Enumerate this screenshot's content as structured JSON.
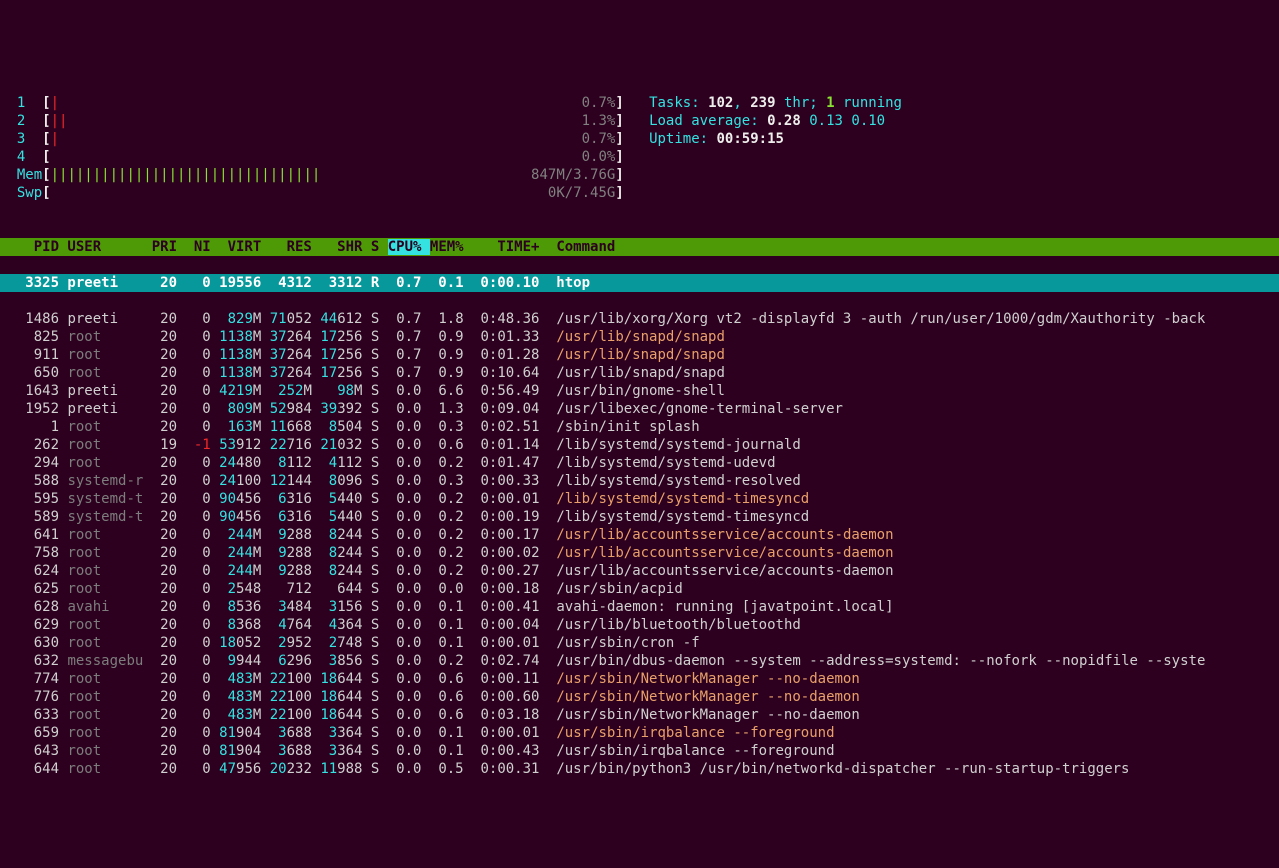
{
  "cpus": [
    {
      "id": "1",
      "bar": "|",
      "barClass": "red",
      "pct": "0.7%"
    },
    {
      "id": "2",
      "bar": "||",
      "barClass": "red",
      "pct": "1.3%"
    },
    {
      "id": "3",
      "bar": "|",
      "barClass": "red",
      "pct": "0.7%"
    },
    {
      "id": "4",
      "bar": "",
      "barClass": "",
      "pct": "0.0%"
    }
  ],
  "mem": {
    "label": "Mem",
    "bar": "||||||||||||||||||||||||||||||||",
    "value": "847M/3.76G"
  },
  "swp": {
    "label": "Swp",
    "bar": "",
    "value": "0K/7.45G"
  },
  "tasks": {
    "label": "Tasks:",
    "count": "102",
    "sep": ",",
    "thr": "239",
    "thrLabel": "thr;",
    "running": "1",
    "runningLabel": "running"
  },
  "load": {
    "label": "Load average:",
    "v1": "0.28",
    "v2": "0.13",
    "v3": "0.10"
  },
  "uptime": {
    "label": "Uptime:",
    "value": "00:59:15"
  },
  "columns": {
    "pid": "PID",
    "user": "USER",
    "pri": "PRI",
    "ni": "NI",
    "virt": "VIRT",
    "res": "RES",
    "shr": "SHR",
    "s": "S",
    "cpu": "CPU%",
    "mem": "MEM%",
    "time": "TIME+",
    "cmd": "Command"
  },
  "selected": {
    "pid": "3325",
    "user": "preeti",
    "pri": "20",
    "ni": "0",
    "virt": "19556",
    "res": "4312",
    "shr": "3312",
    "s": "R",
    "cpu": "0.7",
    "mem": "0.1",
    "time": "0:00.10",
    "cmd": "htop"
  },
  "rows": [
    {
      "pid": "1486",
      "user": "preeti",
      "userDim": false,
      "pri": "20",
      "ni": "0",
      "virtHi": "829",
      "virtLo": "M",
      "resHi": "71",
      "resLo": "052",
      "shrHi": "44",
      "shrLo": "612",
      "s": "S",
      "cpu": "0.7",
      "mem": "1.8",
      "time": "0:48.36",
      "cmd": "/usr/lib/xorg/Xorg vt2 -displayfd 3 -auth /run/user/1000/gdm/Xauthority -back",
      "cmdDim": false
    },
    {
      "pid": "825",
      "user": "root",
      "userDim": true,
      "pri": "20",
      "ni": "0",
      "virtHi": "1138",
      "virtLo": "M",
      "resHi": "37",
      "resLo": "264",
      "shrHi": "17",
      "shrLo": "256",
      "s": "S",
      "cpu": "0.7",
      "mem": "0.9",
      "time": "0:01.33",
      "cmd": "/usr/lib/snapd/snapd",
      "cmdDim": true
    },
    {
      "pid": "911",
      "user": "root",
      "userDim": true,
      "pri": "20",
      "ni": "0",
      "virtHi": "1138",
      "virtLo": "M",
      "resHi": "37",
      "resLo": "264",
      "shrHi": "17",
      "shrLo": "256",
      "s": "S",
      "cpu": "0.7",
      "mem": "0.9",
      "time": "0:01.28",
      "cmd": "/usr/lib/snapd/snapd",
      "cmdDim": true
    },
    {
      "pid": "650",
      "user": "root",
      "userDim": true,
      "pri": "20",
      "ni": "0",
      "virtHi": "1138",
      "virtLo": "M",
      "resHi": "37",
      "resLo": "264",
      "shrHi": "17",
      "shrLo": "256",
      "s": "S",
      "cpu": "0.7",
      "mem": "0.9",
      "time": "0:10.64",
      "cmd": "/usr/lib/snapd/snapd",
      "cmdDim": false
    },
    {
      "pid": "1643",
      "user": "preeti",
      "userDim": false,
      "pri": "20",
      "ni": "0",
      "virtHi": "4219",
      "virtLo": "M",
      "resHi": "252",
      "resLo": "M",
      "shrHi": "98",
      "shrLo": "M",
      "s": "S",
      "cpu": "0.0",
      "mem": "6.6",
      "time": "0:56.49",
      "cmd": "/usr/bin/gnome-shell",
      "cmdDim": false
    },
    {
      "pid": "1952",
      "user": "preeti",
      "userDim": false,
      "pri": "20",
      "ni": "0",
      "virtHi": "809",
      "virtLo": "M",
      "resHi": "52",
      "resLo": "984",
      "shrHi": "39",
      "shrLo": "392",
      "s": "S",
      "cpu": "0.0",
      "mem": "1.3",
      "time": "0:09.04",
      "cmd": "/usr/libexec/gnome-terminal-server",
      "cmdDim": false
    },
    {
      "pid": "1",
      "user": "root",
      "userDim": true,
      "pri": "20",
      "ni": "0",
      "virtHi": "163",
      "virtLo": "M",
      "resHi": "11",
      "resLo": "668",
      "shrHi": "8",
      "shrLo": "504",
      "s": "S",
      "cpu": "0.0",
      "mem": "0.3",
      "time": "0:02.51",
      "cmd": "/sbin/init splash",
      "cmdDim": false
    },
    {
      "pid": "262",
      "user": "root",
      "userDim": true,
      "pri": "19",
      "ni": "-1",
      "niRed": true,
      "virtHi": "53",
      "virtLo": "912",
      "resHi": "22",
      "resLo": "716",
      "shrHi": "21",
      "shrLo": "032",
      "s": "S",
      "cpu": "0.0",
      "mem": "0.6",
      "time": "0:01.14",
      "cmd": "/lib/systemd/systemd-journald",
      "cmdDim": false
    },
    {
      "pid": "294",
      "user": "root",
      "userDim": true,
      "pri": "20",
      "ni": "0",
      "virtHi": "24",
      "virtLo": "480",
      "resHi": "8",
      "resLo": "112",
      "shrHi": "4",
      "shrLo": "112",
      "s": "S",
      "cpu": "0.0",
      "mem": "0.2",
      "time": "0:01.47",
      "cmd": "/lib/systemd/systemd-udevd",
      "cmdDim": false
    },
    {
      "pid": "588",
      "user": "systemd-r",
      "userDim": true,
      "pri": "20",
      "ni": "0",
      "virtHi": "24",
      "virtLo": "100",
      "resHi": "12",
      "resLo": "144",
      "shrHi": "8",
      "shrLo": "096",
      "s": "S",
      "cpu": "0.0",
      "mem": "0.3",
      "time": "0:00.33",
      "cmd": "/lib/systemd/systemd-resolved",
      "cmdDim": false
    },
    {
      "pid": "595",
      "user": "systemd-t",
      "userDim": true,
      "pri": "20",
      "ni": "0",
      "virtHi": "90",
      "virtLo": "456",
      "resHi": "6",
      "resLo": "316",
      "shrHi": "5",
      "shrLo": "440",
      "s": "S",
      "cpu": "0.0",
      "mem": "0.2",
      "time": "0:00.01",
      "cmd": "/lib/systemd/systemd-timesyncd",
      "cmdDim": true
    },
    {
      "pid": "589",
      "user": "systemd-t",
      "userDim": true,
      "pri": "20",
      "ni": "0",
      "virtHi": "90",
      "virtLo": "456",
      "resHi": "6",
      "resLo": "316",
      "shrHi": "5",
      "shrLo": "440",
      "s": "S",
      "cpu": "0.0",
      "mem": "0.2",
      "time": "0:00.19",
      "cmd": "/lib/systemd/systemd-timesyncd",
      "cmdDim": false
    },
    {
      "pid": "641",
      "user": "root",
      "userDim": true,
      "pri": "20",
      "ni": "0",
      "virtHi": "244",
      "virtLo": "M",
      "resHi": "9",
      "resLo": "288",
      "shrHi": "8",
      "shrLo": "244",
      "s": "S",
      "cpu": "0.0",
      "mem": "0.2",
      "time": "0:00.17",
      "cmd": "/usr/lib/accountsservice/accounts-daemon",
      "cmdDim": true
    },
    {
      "pid": "758",
      "user": "root",
      "userDim": true,
      "pri": "20",
      "ni": "0",
      "virtHi": "244",
      "virtLo": "M",
      "resHi": "9",
      "resLo": "288",
      "shrHi": "8",
      "shrLo": "244",
      "s": "S",
      "cpu": "0.0",
      "mem": "0.2",
      "time": "0:00.02",
      "cmd": "/usr/lib/accountsservice/accounts-daemon",
      "cmdDim": true
    },
    {
      "pid": "624",
      "user": "root",
      "userDim": true,
      "pri": "20",
      "ni": "0",
      "virtHi": "244",
      "virtLo": "M",
      "resHi": "9",
      "resLo": "288",
      "shrHi": "8",
      "shrLo": "244",
      "s": "S",
      "cpu": "0.0",
      "mem": "0.2",
      "time": "0:00.27",
      "cmd": "/usr/lib/accountsservice/accounts-daemon",
      "cmdDim": false
    },
    {
      "pid": "625",
      "user": "root",
      "userDim": true,
      "pri": "20",
      "ni": "0",
      "virtHi": "2",
      "virtLo": "548",
      "resHi": "",
      "resLo": "712",
      "shrHi": "",
      "shrLo": "644",
      "s": "S",
      "cpu": "0.0",
      "mem": "0.0",
      "time": "0:00.18",
      "cmd": "/usr/sbin/acpid",
      "cmdDim": false
    },
    {
      "pid": "628",
      "user": "avahi",
      "userDim": true,
      "pri": "20",
      "ni": "0",
      "virtHi": "8",
      "virtLo": "536",
      "resHi": "3",
      "resLo": "484",
      "shrHi": "3",
      "shrLo": "156",
      "s": "S",
      "cpu": "0.0",
      "mem": "0.1",
      "time": "0:00.41",
      "cmd": "avahi-daemon: running [javatpoint.local]",
      "cmdDim": false
    },
    {
      "pid": "629",
      "user": "root",
      "userDim": true,
      "pri": "20",
      "ni": "0",
      "virtHi": "8",
      "virtLo": "368",
      "resHi": "4",
      "resLo": "764",
      "shrHi": "4",
      "shrLo": "364",
      "s": "S",
      "cpu": "0.0",
      "mem": "0.1",
      "time": "0:00.04",
      "cmd": "/usr/lib/bluetooth/bluetoothd",
      "cmdDim": false
    },
    {
      "pid": "630",
      "user": "root",
      "userDim": true,
      "pri": "20",
      "ni": "0",
      "virtHi": "18",
      "virtLo": "052",
      "resHi": "2",
      "resLo": "952",
      "shrHi": "2",
      "shrLo": "748",
      "s": "S",
      "cpu": "0.0",
      "mem": "0.1",
      "time": "0:00.01",
      "cmd": "/usr/sbin/cron -f",
      "cmdDim": false
    },
    {
      "pid": "632",
      "user": "messagebu",
      "userDim": true,
      "pri": "20",
      "ni": "0",
      "virtHi": "9",
      "virtLo": "944",
      "resHi": "6",
      "resLo": "296",
      "shrHi": "3",
      "shrLo": "856",
      "s": "S",
      "cpu": "0.0",
      "mem": "0.2",
      "time": "0:02.74",
      "cmd": "/usr/bin/dbus-daemon --system --address=systemd: --nofork --nopidfile --syste",
      "cmdDim": false
    },
    {
      "pid": "774",
      "user": "root",
      "userDim": true,
      "pri": "20",
      "ni": "0",
      "virtHi": "483",
      "virtLo": "M",
      "resHi": "22",
      "resLo": "100",
      "shrHi": "18",
      "shrLo": "644",
      "s": "S",
      "cpu": "0.0",
      "mem": "0.6",
      "time": "0:00.11",
      "cmd": "/usr/sbin/NetworkManager --no-daemon",
      "cmdDim": true
    },
    {
      "pid": "776",
      "user": "root",
      "userDim": true,
      "pri": "20",
      "ni": "0",
      "virtHi": "483",
      "virtLo": "M",
      "resHi": "22",
      "resLo": "100",
      "shrHi": "18",
      "shrLo": "644",
      "s": "S",
      "cpu": "0.0",
      "mem": "0.6",
      "time": "0:00.60",
      "cmd": "/usr/sbin/NetworkManager --no-daemon",
      "cmdDim": true
    },
    {
      "pid": "633",
      "user": "root",
      "userDim": true,
      "pri": "20",
      "ni": "0",
      "virtHi": "483",
      "virtLo": "M",
      "resHi": "22",
      "resLo": "100",
      "shrHi": "18",
      "shrLo": "644",
      "s": "S",
      "cpu": "0.0",
      "mem": "0.6",
      "time": "0:03.18",
      "cmd": "/usr/sbin/NetworkManager --no-daemon",
      "cmdDim": false
    },
    {
      "pid": "659",
      "user": "root",
      "userDim": true,
      "pri": "20",
      "ni": "0",
      "virtHi": "81",
      "virtLo": "904",
      "resHi": "3",
      "resLo": "688",
      "shrHi": "3",
      "shrLo": "364",
      "s": "S",
      "cpu": "0.0",
      "mem": "0.1",
      "time": "0:00.01",
      "cmd": "/usr/sbin/irqbalance --foreground",
      "cmdDim": true
    },
    {
      "pid": "643",
      "user": "root",
      "userDim": true,
      "pri": "20",
      "ni": "0",
      "virtHi": "81",
      "virtLo": "904",
      "resHi": "3",
      "resLo": "688",
      "shrHi": "3",
      "shrLo": "364",
      "s": "S",
      "cpu": "0.0",
      "mem": "0.1",
      "time": "0:00.43",
      "cmd": "/usr/sbin/irqbalance --foreground",
      "cmdDim": false
    },
    {
      "pid": "644",
      "user": "root",
      "userDim": true,
      "pri": "20",
      "ni": "0",
      "virtHi": "47",
      "virtLo": "956",
      "resHi": "20",
      "resLo": "232",
      "shrHi": "11",
      "shrLo": "988",
      "s": "S",
      "cpu": "0.0",
      "mem": "0.5",
      "time": "0:00.31",
      "cmd": "/usr/bin/python3 /usr/bin/networkd-dispatcher --run-startup-triggers",
      "cmdDim": false
    }
  ]
}
